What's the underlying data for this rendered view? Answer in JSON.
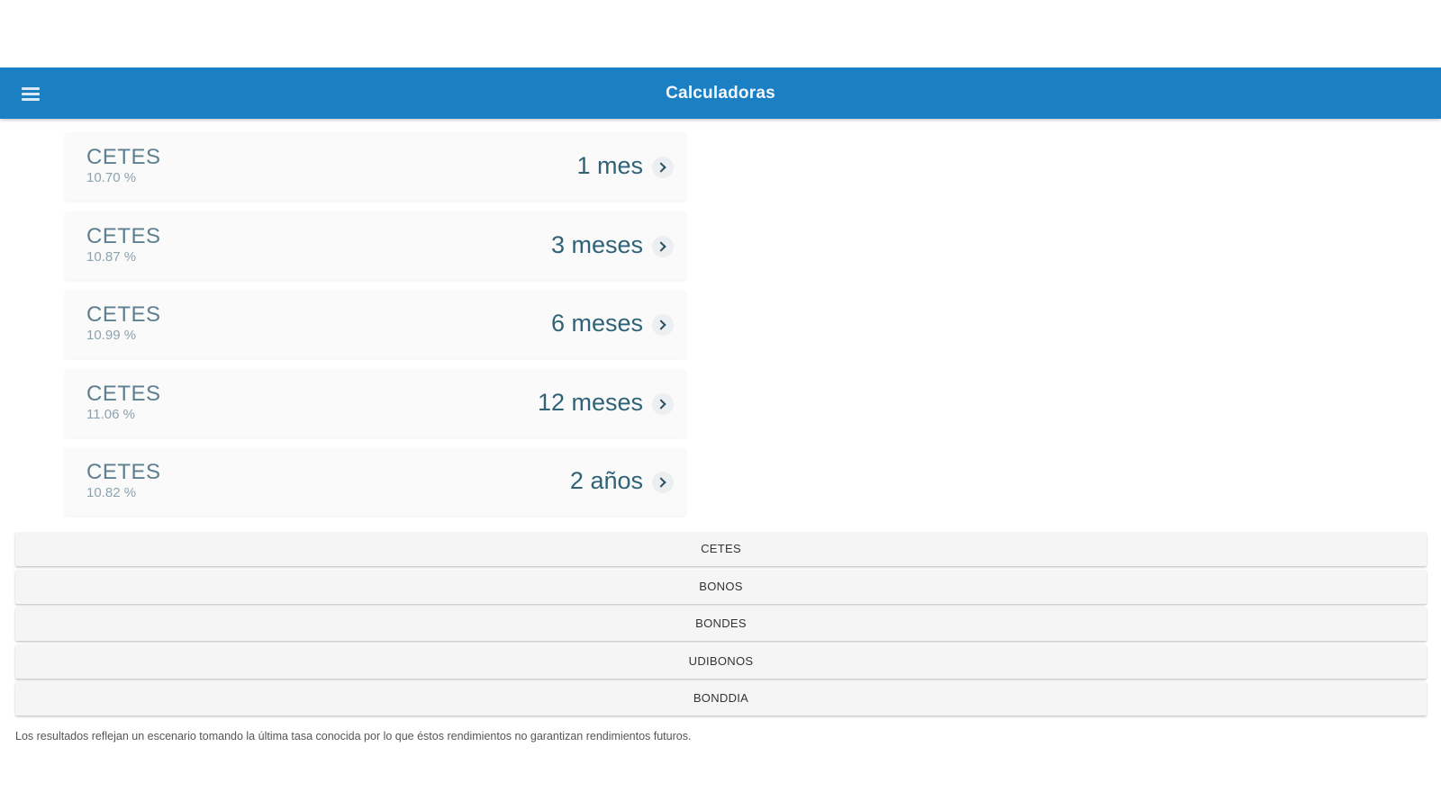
{
  "appbar": {
    "title": "Calculadoras",
    "menu_icon": "hamburger-menu-icon",
    "color": "#1b7fc4"
  },
  "rates": [
    {
      "name": "CETES",
      "rate": "10.70 %",
      "term": "1 mes"
    },
    {
      "name": "CETES",
      "rate": "10.87 %",
      "term": "3 meses"
    },
    {
      "name": "CETES",
      "rate": "10.99 %",
      "term": "6 meses"
    },
    {
      "name": "CETES",
      "rate": "11.06 %",
      "term": "12 meses"
    },
    {
      "name": "CETES",
      "rate": "10.82 %",
      "term": "2 años"
    }
  ],
  "instruments": [
    "CETES",
    "BONOS",
    "BONDES",
    "UDIBONOS",
    "BONDDIA"
  ],
  "disclaimer": "Los resultados reflejan un escenario tomando la última tasa conocida por lo que éstos rendimientos no garantizan rendimientos futuros."
}
